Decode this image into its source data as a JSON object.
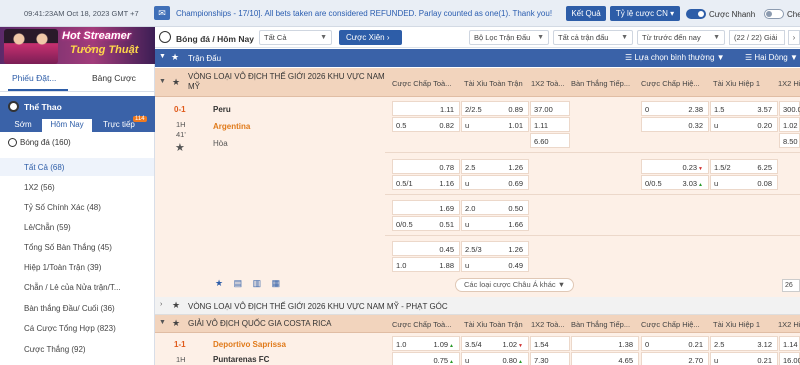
{
  "topbar": {
    "time": "09:41:23AM Oct 18, 2023 GMT +7",
    "marquee": "Championships - 17/10]. All bets taken are considered REFUNDED. Parlay counted as one(1). Thank you!",
    "result_btn": "Kết Quả",
    "odds_btn": "Tỷ lệ cược CN",
    "odds_btn_chevron": "▾",
    "quick_bet_label": "Cược Nhanh",
    "dark_label": "Che"
  },
  "banner": {
    "line1": "Hot Streamer",
    "line2": "Tướng Thuật"
  },
  "sidebar": {
    "tab1": "Phiếu Đặt...",
    "tab2": "Bảng Cược",
    "sport_title": "Thể Thao",
    "date_tabs": [
      "Sớm",
      "Hôm Nay",
      "Trực tiếp"
    ],
    "live_count": "114",
    "sport_item": "Bóng đá (160)",
    "items": [
      "Tất Cả (68)",
      "1X2 (56)",
      "Tỷ Số Chính Xác (48)",
      "Lẻ/Chẵn (59)",
      "Tổng Số Bàn Thắng (45)",
      "Hiệp 1/Toàn Trận (39)",
      "Chẵn / Lẻ của Nửa trận/T...",
      "Bàn thắng Đầu/ Cuối (36)",
      "Cá Cược Tổng Hợp (823)",
      "Cược Thắng (92)"
    ]
  },
  "main": {
    "crumb": "Bóng đá / Hôm Nay",
    "select_all": "Tất Cả",
    "xien_btn": "Cược Xiên",
    "xien_arrow": "›",
    "filter_match": "Bộ Lọc Trận Đấu",
    "filter_all_match": "Tất cả trận đấu",
    "filter_time": "Từ trước đến nay",
    "pager": "(22 / 22) Giải",
    "pager_arrow": "›",
    "section": "Trận Đấu",
    "view_select": "Lựa chọn bình thường",
    "view_mode": "Hai Dòng",
    "col_headers": [
      "Cược Chấp Toà...",
      "Tài Xỉu Toàn Trận",
      "1X2 Toà...",
      "Bàn Thắng Tiếp...",
      "Cược Chấp Hiệ...",
      "Tài Xỉu Hiệp 1",
      "1X2 Hi..."
    ],
    "league1": "VÒNG LOẠI VÔ ĐỊCH THẾ GIỚI 2026 KHU VỰC NAM MỸ",
    "match1": {
      "score": "0-1",
      "period": "1H",
      "minute": "41'",
      "home": "Peru",
      "away": "Argentina",
      "draw": "Hòa"
    },
    "more_btn": "Các loại cược Châu Á khác",
    "page_select": "26",
    "league2": "VÒNG LOẠI VÔ ĐỊCH THẾ GIỚI 2026 KHU VỰC NAM MỸ - PHẠT GÓC",
    "league3": "GIẢI VÔ ĐỊCH QUỐC GIA COSTA RICA",
    "match2": {
      "score": "1-1",
      "period": "1H",
      "home": "Deportivo Saprissa",
      "away": "Puntarenas FC"
    },
    "rows": [
      {
        "c1h": "",
        "c1o": "1.11",
        "c2h": "2/2.5",
        "c2o": "0.89",
        "c3": "37.00",
        "c5h": "0",
        "c5o": "2.38",
        "c6h": "1.5",
        "c6o": "3.57",
        "c7": "300.0"
      },
      {
        "c1h": "0.5",
        "c1o": "0.82",
        "c2h": "u",
        "c2o": "1.01",
        "c3": "1.11",
        "c5h": "",
        "c5o": "0.32",
        "c6h": "u",
        "c6o": "0.20",
        "c7": "1.02"
      },
      {
        "c3": "6.60",
        "c7": "8.50"
      },
      {
        "c1h": "",
        "c1o": "0.78",
        "c2h": "2.5",
        "c2o": "1.26",
        "c5h": "",
        "c5o": "0.23",
        "c6h": "1.5/2",
        "c6o": "6.25"
      },
      {
        "c1h": "0.5/1",
        "c1o": "1.16",
        "c2h": "u",
        "c2o": "0.69",
        "c5h": "0/0.5",
        "c5o": "3.03",
        "c6h": "u",
        "c6o": "0.08"
      },
      {
        "c1h": "",
        "c1o": "1.69",
        "c2h": "2.0",
        "c2o": "0.50"
      },
      {
        "c1h": "0/0.5",
        "c1o": "0.51",
        "c2h": "u",
        "c2o": "1.66"
      },
      {
        "c1h": "",
        "c1o": "0.45",
        "c2h": "2.5/3",
        "c2o": "1.26"
      },
      {
        "c1h": "1.0",
        "c1o": "1.88",
        "c2h": "u",
        "c2o": "0.49"
      }
    ],
    "m2row1": {
      "c1h": "1.0",
      "c1o": "1.09",
      "c2h": "3.5/4",
      "c2o": "1.02",
      "c3": "1.54",
      "c4": "1.38",
      "c5h": "0",
      "c5o": "0.21",
      "c6h": "2.5",
      "c6o": "3.12",
      "c7": "1.14"
    },
    "m2row2": {
      "c1o": "0.75",
      "c2o": "0.80",
      "c3": "7.30",
      "c4": "4.65",
      "c5o": "2.70",
      "c6o": "0.21",
      "c7": "16.00"
    },
    "star": "★",
    "arrow_down": "▼",
    "arrow_right": "›"
  }
}
